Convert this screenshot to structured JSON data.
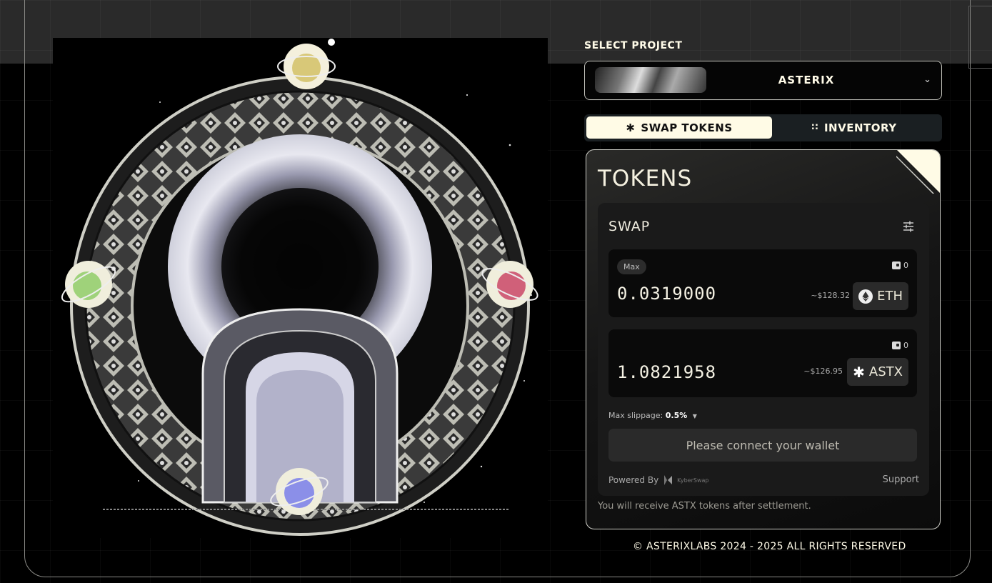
{
  "select_project": {
    "label": "SELECT PROJECT",
    "selected": "ASTERIX",
    "chevron_icon": "chevron-down-icon"
  },
  "tabs": [
    {
      "label": "SWAP TOKENS",
      "icon": "asterisk-icon",
      "active": true
    },
    {
      "label": "INVENTORY",
      "icon": "grid-dots-icon",
      "active": false
    }
  ],
  "card": {
    "title": "TOKENS",
    "swap": {
      "title": "SWAP",
      "settings_icon": "sliders-icon",
      "from": {
        "max_label": "Max",
        "balance": "0",
        "amount": "0.0319000",
        "usd": "~$128.32",
        "symbol": "ETH"
      },
      "to": {
        "balance": "0",
        "amount": "1.0821958",
        "usd": "~$126.95",
        "symbol": "ASTX"
      },
      "slippage_label": "Max slippage:",
      "slippage_value": "0.5%",
      "connect_label": "Please connect your wallet",
      "powered_by": "Powered By",
      "provider": "KyberSwap",
      "support_label": "Support"
    },
    "receive_note": "You will receive ASTX tokens after settlement."
  },
  "footer": {
    "copyright": "© ASTERIXLABS 2024 - 2025 ALL RIGHTS RESERVED"
  },
  "colors": {
    "accent_cream": "#fffbe6",
    "background": "#000000",
    "panel": "#1a1a1a",
    "planet_yellow": "#d8c878",
    "planet_green": "#9fd27a",
    "planet_pink": "#d06079",
    "planet_blue": "#8b8fe8"
  }
}
